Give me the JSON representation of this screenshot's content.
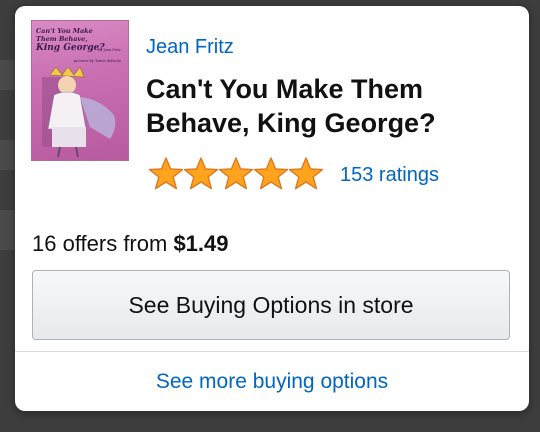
{
  "product": {
    "author": "Jean Fritz",
    "title": "Can't You Make Them Behave, King George?",
    "rating_stars": 5,
    "ratings_count_label": "153 ratings",
    "offers_prefix": "16 offers from ",
    "offers_price": "$1.49",
    "buy_button_label": "See Buying Options in store",
    "more_link_label": "See more buying options"
  },
  "cover": {
    "title_line1": "Can't You Make Them Behave,",
    "title_line2": "King George?",
    "author_line": "by Jean Fritz",
    "illustrator_line": "pictures by Tomie dePaola",
    "icon": "book-cover-image"
  },
  "colors": {
    "link": "#0066c0",
    "star_fill": "#ffa41c",
    "star_stroke": "#de7921",
    "text": "#111111"
  }
}
